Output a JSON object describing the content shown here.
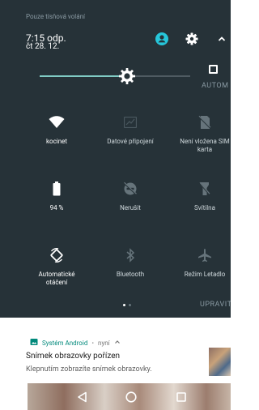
{
  "status_bar": {
    "carrier_text": "Pouze tísňová volání"
  },
  "header": {
    "time": "7:15 odp.",
    "date": "čt 28. 12."
  },
  "brightness": {
    "level": 0.58,
    "auto_label": "AUTOM"
  },
  "tiles": [
    {
      "label": "kocinet",
      "icon": "wifi-icon",
      "active": true
    },
    {
      "label": "Datové připojení",
      "icon": "mobile-data-icon",
      "active": false
    },
    {
      "label": "Není vložena SIM karta",
      "icon": "no-sim-icon",
      "active": false
    },
    {
      "label": "94 %",
      "icon": "battery-icon",
      "active": true
    },
    {
      "label": "Nerušit",
      "icon": "do-not-disturb-icon",
      "active": false
    },
    {
      "label": "Svítilna",
      "icon": "flashlight-icon",
      "active": false
    },
    {
      "label": "Automatické otáčení",
      "icon": "auto-rotate-icon",
      "active": true
    },
    {
      "label": "Bluetooth",
      "icon": "bluetooth-icon",
      "active": false
    },
    {
      "label": "Režim Letadlo",
      "icon": "airplane-icon",
      "active": false
    }
  ],
  "pager": {
    "pages": 2,
    "current": 1
  },
  "edit_label": "UPRAVIT",
  "notification": {
    "app": "Systém Android",
    "time": "nyní",
    "title": "Snímek obrazovky pořízen",
    "text": "Klepnutím zobrazíte snímek obrazovky."
  },
  "colors": {
    "shade_bg": "#263238",
    "accent": "#80cbc4",
    "user_icon": "#26c6da",
    "notif_app": "#00897b"
  }
}
